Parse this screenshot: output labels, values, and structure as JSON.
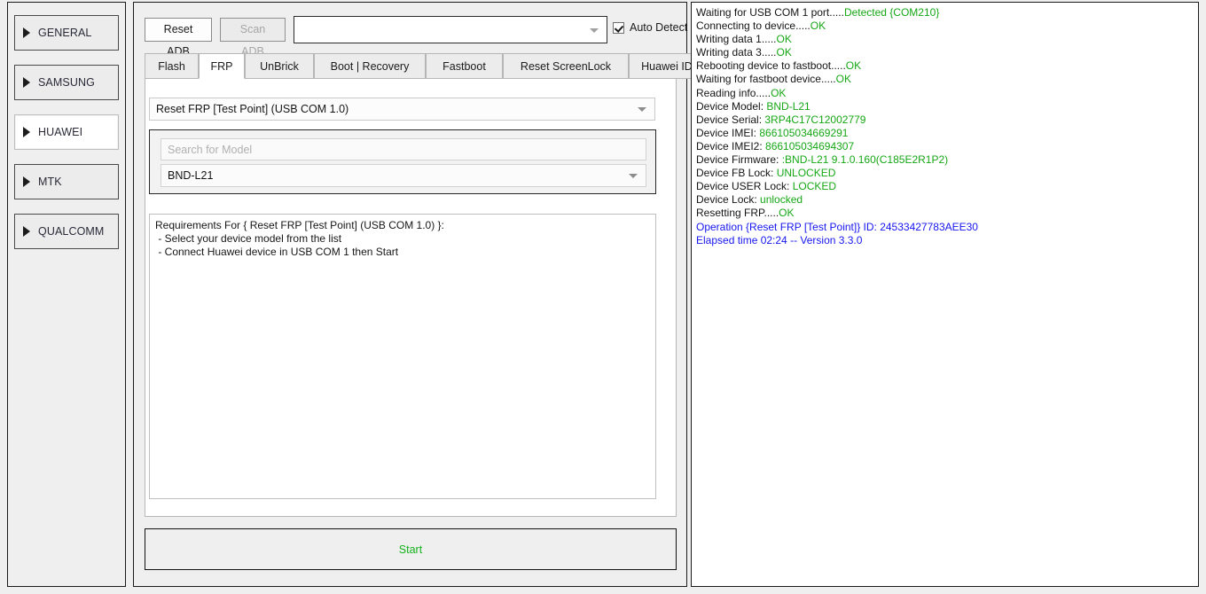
{
  "colors": {
    "ok_green": "#16a716",
    "info_blue": "#1616ee",
    "start_green": "#14b21a",
    "panel_bg": "#efefef",
    "border_dark": "#1a1a1a"
  },
  "sidebar": {
    "items": [
      {
        "label": "GENERAL",
        "icon": "triangle-right-icon",
        "active": false
      },
      {
        "label": "SAMSUNG",
        "icon": "triangle-right-icon",
        "active": false
      },
      {
        "label": "HUAWEI",
        "icon": "triangle-right-icon",
        "active": true
      },
      {
        "label": "MTK",
        "icon": "triangle-right-icon",
        "active": false
      },
      {
        "label": "QUALCOMM",
        "icon": "triangle-right-icon",
        "active": false
      }
    ]
  },
  "toolbar": {
    "reset_adb_label": "Reset ADB",
    "scan_adb_label": "Scan ADB",
    "scan_adb_disabled": true,
    "com_combo_value": "",
    "com_combo_icon": "chevron-down-icon",
    "auto_detect_label": "Auto Detect",
    "auto_detect_checked": true
  },
  "tabs": [
    {
      "label": "Flash",
      "active": false
    },
    {
      "label": "FRP",
      "active": true
    },
    {
      "label": "UnBrick",
      "active": false
    },
    {
      "label": "Boot | Recovery",
      "active": false
    },
    {
      "label": "Fastboot",
      "active": false
    },
    {
      "label": "Reset ScreenLock",
      "active": false
    },
    {
      "label": "Huawei ID",
      "active": false
    }
  ],
  "frp_tab": {
    "operation_value": "Reset FRP [Test Point] (USB COM 1.0)",
    "operation_icon": "chevron-down-icon",
    "model_search_placeholder": "Search for Model",
    "model_search_value": "",
    "model_value": "BND-L21",
    "model_icon": "chevron-down-icon",
    "requirements": [
      "Requirements For { Reset FRP [Test Point] (USB COM 1.0) }:",
      " - Select your device model from the list",
      " - Connect Huawei device in USB COM 1 then Start"
    ]
  },
  "start_button": {
    "label": "Start"
  },
  "log": {
    "lines": [
      {
        "label": "Waiting for USB COM 1 port.....",
        "value": "Detected {COM210}",
        "style": "ok"
      },
      {
        "label": "Connecting to device.....",
        "value": "OK",
        "style": "ok"
      },
      {
        "label": "Writing data 1.....",
        "value": "OK",
        "style": "ok"
      },
      {
        "label": "Writing data 3.....",
        "value": "OK",
        "style": "ok"
      },
      {
        "label": "Rebooting device to fastboot.....",
        "value": "OK",
        "style": "ok"
      },
      {
        "label": "Waiting for fastboot device.....",
        "value": "OK",
        "style": "ok"
      },
      {
        "label": "Reading info.....",
        "value": "OK",
        "style": "ok"
      },
      {
        "label": "Device Model: ",
        "value": "BND-L21",
        "style": "ok"
      },
      {
        "label": "Device Serial: ",
        "value": "3RP4C17C12002779",
        "style": "ok"
      },
      {
        "label": "Device IMEI: ",
        "value": "866105034669291",
        "style": "ok"
      },
      {
        "label": "Device IMEI2: ",
        "value": "866105034694307",
        "style": "ok"
      },
      {
        "label": "Device Firmware: ",
        "value": ":BND-L21 9.1.0.160(C185E2R1P2)",
        "style": "ok"
      },
      {
        "label": "Device FB Lock: ",
        "value": "UNLOCKED",
        "style": "ok"
      },
      {
        "label": "Device USER Lock: ",
        "value": "LOCKED",
        "style": "ok"
      },
      {
        "label": "Device Lock: ",
        "value": "unlocked",
        "style": "ok"
      },
      {
        "label": "Resetting FRP.....",
        "value": "OK",
        "style": "ok"
      },
      {
        "label": "Operation {Reset FRP [Test Point]} ID: 24533427783AEE30",
        "value": "",
        "style": "blue"
      },
      {
        "label": "Elapsed time 02:24 -- Version 3.3.0",
        "value": "",
        "style": "blue"
      }
    ]
  }
}
